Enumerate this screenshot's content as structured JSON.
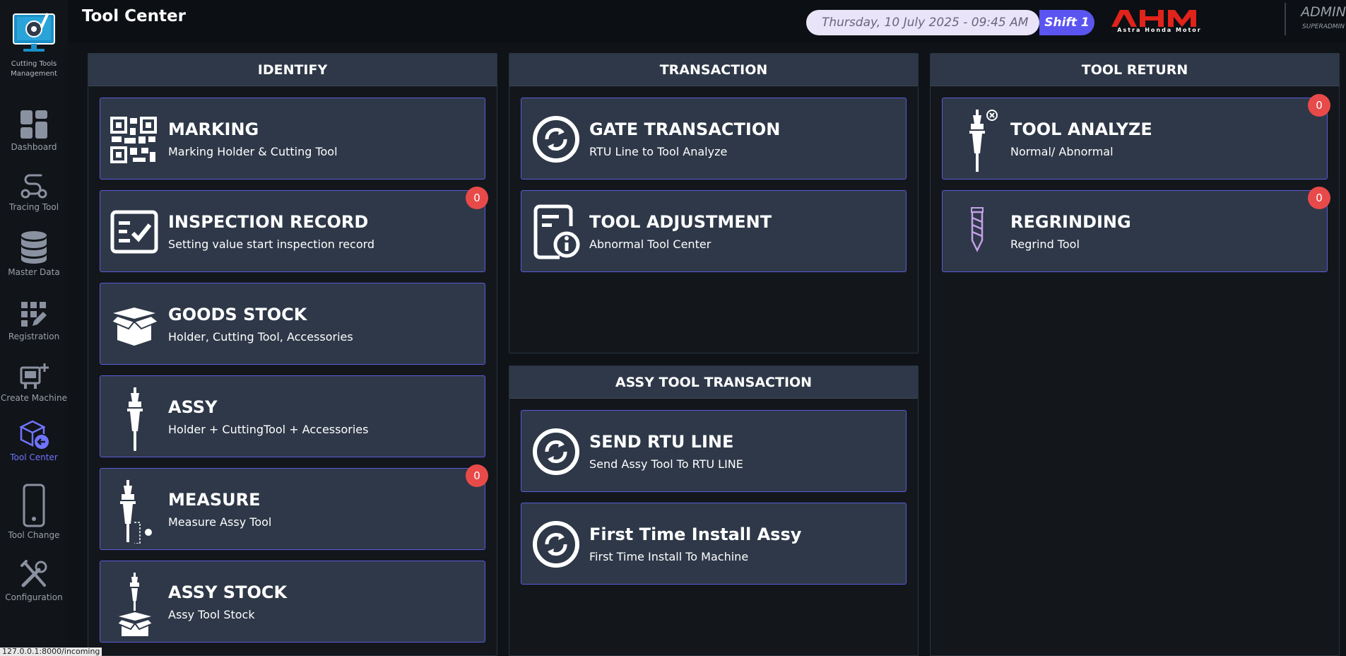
{
  "app": {
    "logo_text": "Cutting Tools Management",
    "page_title": "Tool Center"
  },
  "sidebar": {
    "items": [
      {
        "label": "Dashboard",
        "icon": "dashboard-grid-icon"
      },
      {
        "label": "Tracing Tool",
        "icon": "route-icon"
      },
      {
        "label": "Master Data",
        "icon": "database-icon"
      },
      {
        "label": "Registration",
        "icon": "grid-edit-icon"
      },
      {
        "label": "Create Machine",
        "icon": "machine-plus-icon"
      },
      {
        "label": "Tool Center",
        "icon": "box-return-icon",
        "active": true
      },
      {
        "label": "Tool Change",
        "icon": "smartphone-icon"
      },
      {
        "label": "Configuration",
        "icon": "tools-icon"
      }
    ]
  },
  "header": {
    "datetime": "Thursday, 10 July 2025 - 09:45 AM",
    "shift": "Shift 1",
    "brand": "AHM",
    "brand_sub": "Astra Honda Motor",
    "user_name": "ADMIN",
    "user_role": "SUPERADMIN"
  },
  "panels": {
    "identify": {
      "title": "IDENTIFY",
      "cards": [
        {
          "title": "MARKING",
          "subtitle": "Marking Holder & Cutting Tool",
          "icon": "qr-code-icon"
        },
        {
          "title": "INSPECTION RECORD",
          "subtitle": "Setting value start inspection record",
          "icon": "checklist-icon",
          "badge": "0"
        },
        {
          "title": "GOODS STOCK",
          "subtitle": "Holder, Cutting Tool, Accessories",
          "icon": "open-box-icon"
        },
        {
          "title": "ASSY",
          "subtitle": "Holder + CuttingTool + Accessories",
          "icon": "tool-holder-icon"
        },
        {
          "title": "MEASURE",
          "subtitle": "Measure Assy Tool",
          "icon": "tool-measure-icon",
          "badge": "0"
        },
        {
          "title": "ASSY STOCK",
          "subtitle": "Assy Tool Stock",
          "icon": "tool-box-icon"
        }
      ]
    },
    "transaction": {
      "title": "TRANSACTION",
      "cards": [
        {
          "title": "GATE TRANSACTION",
          "subtitle": "RTU Line to Tool Analyze",
          "icon": "sync-circle-icon"
        },
        {
          "title": "TOOL ADJUSTMENT",
          "subtitle": "Abnormal Tool Center",
          "icon": "document-info-icon"
        }
      ]
    },
    "assy_transaction": {
      "title": "ASSY TOOL TRANSACTION",
      "cards": [
        {
          "title": "SEND RTU LINE",
          "subtitle": "Send Assy Tool To RTU LINE",
          "icon": "sync-circle-icon"
        },
        {
          "title": "First Time Install Assy",
          "subtitle": "First Time Install To Machine",
          "icon": "sync-circle-icon"
        }
      ]
    },
    "tool_return": {
      "title": "TOOL RETURN",
      "cards": [
        {
          "title": "TOOL ANALYZE",
          "subtitle": "Normal/ Abnormal",
          "icon": "tool-abnormal-icon",
          "badge": "0"
        },
        {
          "title": "REGRINDING",
          "subtitle": "Regrind Tool",
          "icon": "drill-bit-icon",
          "badge": "0"
        }
      ]
    }
  },
  "status_bar": {
    "url": "127.0.0.1:8000/incoming"
  },
  "colors": {
    "accent": "#5a55f0",
    "badge": "#e84a4a",
    "card_bg": "#2e3848",
    "card_border": "#5a5bd8",
    "brand_red": "#e0231b"
  }
}
